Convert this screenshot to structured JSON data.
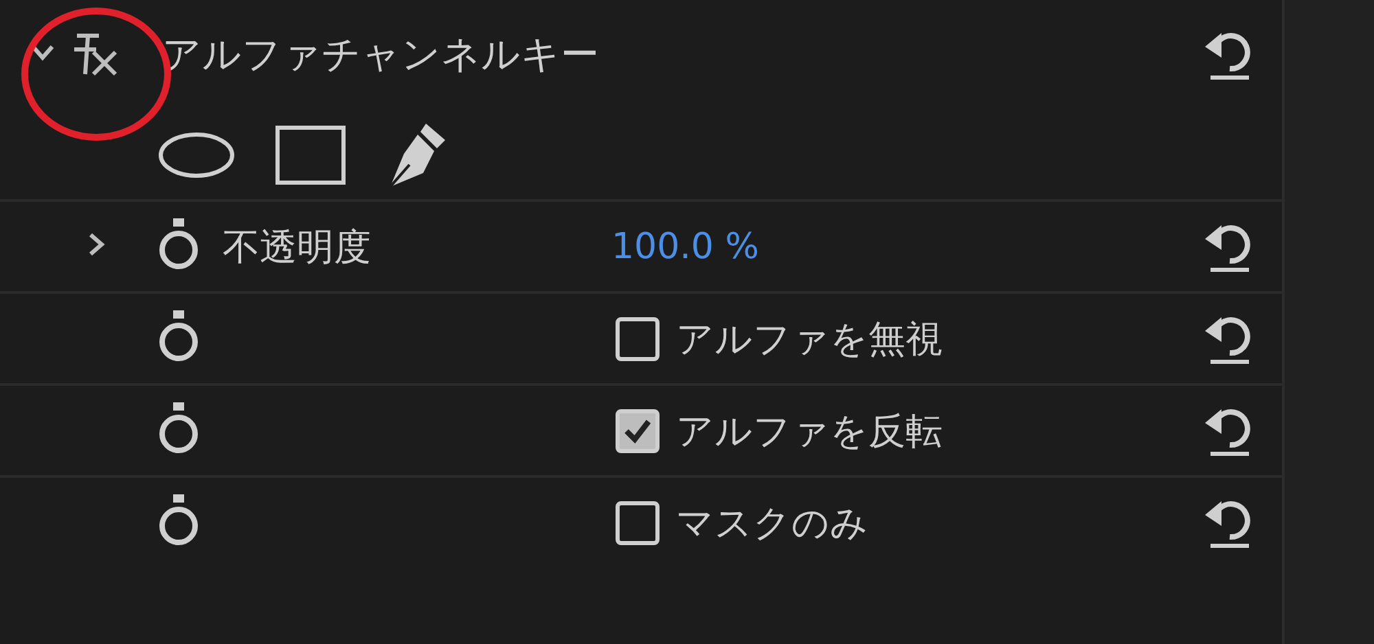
{
  "effect": {
    "title": "アルファチャンネルキー",
    "expanded": true
  },
  "properties": [
    {
      "kind": "value",
      "label": "不透明度",
      "value": "100.0 %",
      "expanded": false
    },
    {
      "kind": "checkbox",
      "label": "アルファを無視",
      "checked": false
    },
    {
      "kind": "checkbox",
      "label": "アルファを反転",
      "checked": true
    },
    {
      "kind": "checkbox",
      "label": "マスクのみ",
      "checked": false
    }
  ]
}
